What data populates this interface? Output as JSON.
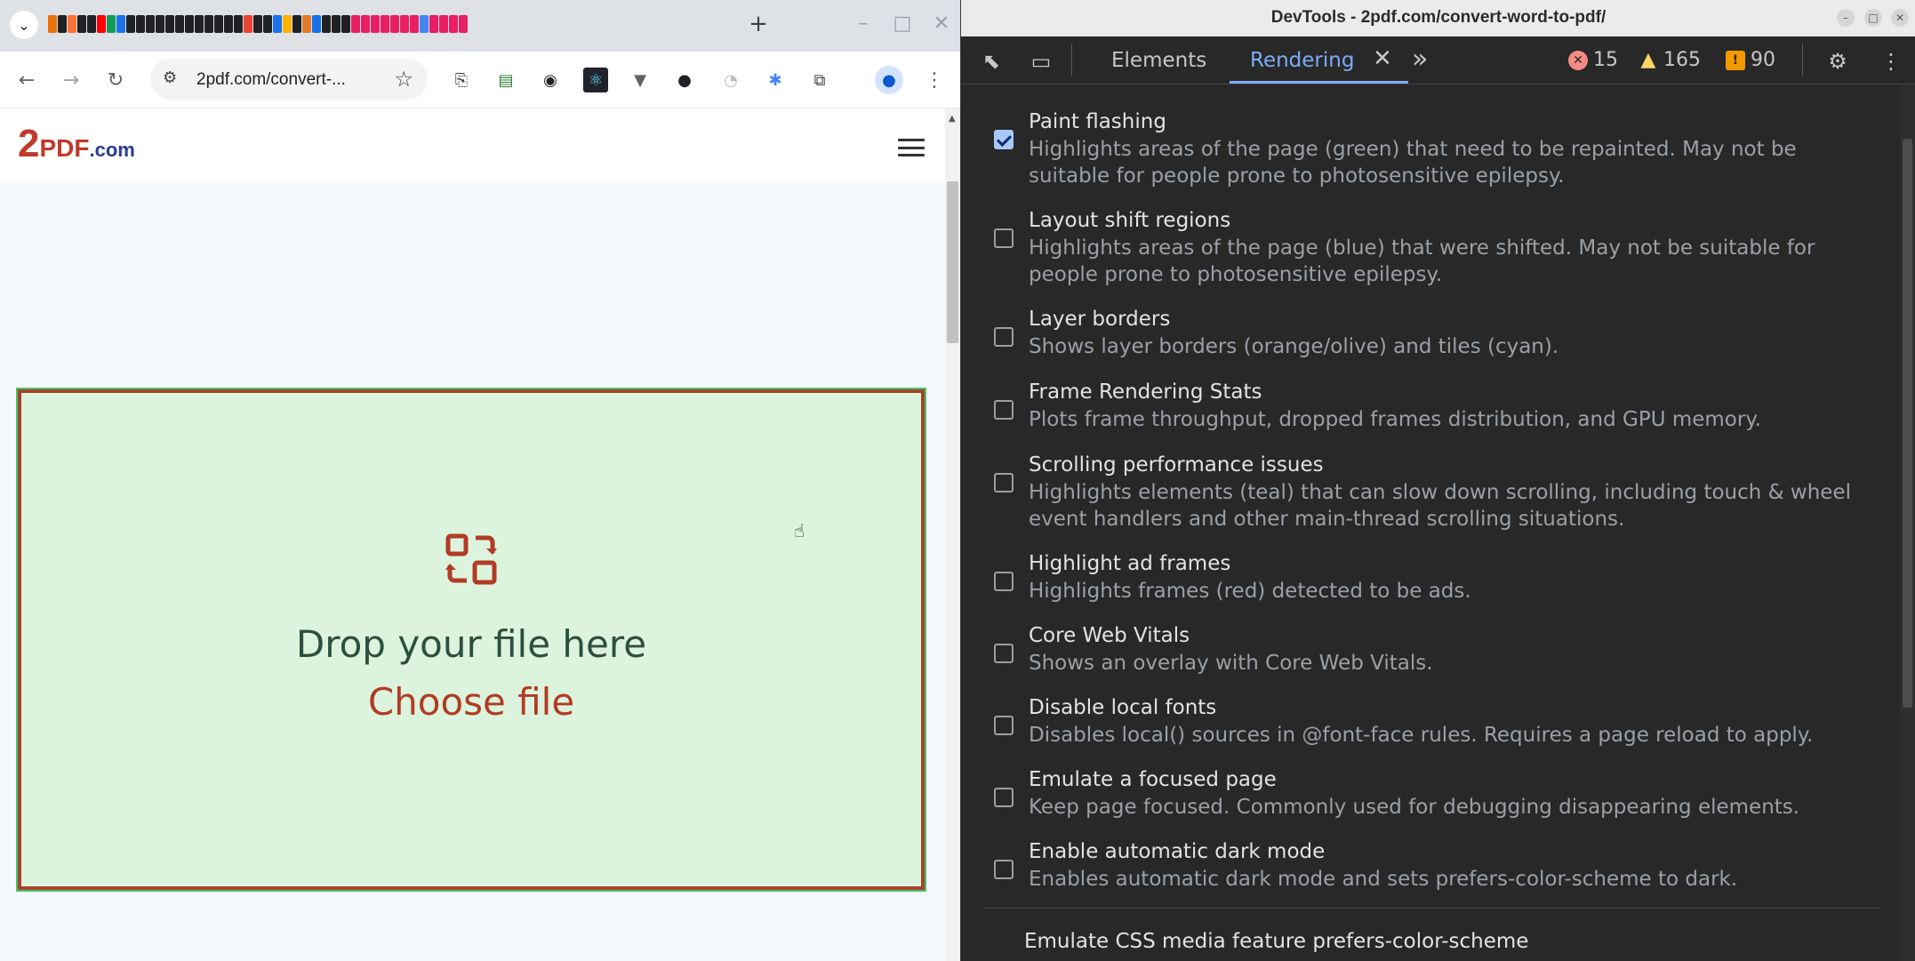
{
  "browser": {
    "url": "2pdf.com/convert-...",
    "new_tab": "+",
    "favicon_colors": [
      "#e8710a",
      "#202124",
      "#ff7139",
      "#202124",
      "#202124",
      "#ff0000",
      "#0f9d58",
      "#1a73e8",
      "#202124",
      "#202124",
      "#202124",
      "#202124",
      "#202124",
      "#202124",
      "#202124",
      "#202124",
      "#202124",
      "#202124",
      "#202124",
      "#202124",
      "#ea4335",
      "#202124",
      "#202124",
      "#1a73e8",
      "#ffb300",
      "#202124",
      "#e37a2a",
      "#1a73e8",
      "#202124",
      "#202124",
      "#202124",
      "#e91e63",
      "#e91e63",
      "#e91e63",
      "#e91e63",
      "#e91e63",
      "#e91e63",
      "#e91e63",
      "#4285f4",
      "#e91e63",
      "#e91e63",
      "#e91e63",
      "#e91e63"
    ],
    "site": {
      "logo_number": "2",
      "logo_text": "PDF",
      "logo_domain": ".com",
      "dropzone_title": "Drop your file here",
      "dropzone_button": "Choose file",
      "accent": "#b23b25",
      "dropzone_bg": "#dcf4dd"
    }
  },
  "devtools": {
    "window_title": "DevTools - 2pdf.com/convert-word-to-pdf/",
    "tabs": {
      "elements": "Elements",
      "rendering": "Rendering"
    },
    "counts": {
      "errors": "15",
      "warnings": "165",
      "issues": "90"
    },
    "options": [
      {
        "title": "Paint flashing",
        "desc": "Highlights areas of the page (green) that need to be repainted. May not be suitable for people prone to photosensitive epilepsy.",
        "checked": true
      },
      {
        "title": "Layout shift regions",
        "desc": "Highlights areas of the page (blue) that were shifted. May not be suitable for people prone to photosensitive epilepsy.",
        "checked": false
      },
      {
        "title": "Layer borders",
        "desc": "Shows layer borders (orange/olive) and tiles (cyan).",
        "checked": false
      },
      {
        "title": "Frame Rendering Stats",
        "desc": "Plots frame throughput, dropped frames distribution, and GPU memory.",
        "checked": false
      },
      {
        "title": "Scrolling performance issues",
        "desc": "Highlights elements (teal) that can slow down scrolling, including touch & wheel event handlers and other main-thread scrolling situations.",
        "checked": false
      },
      {
        "title": "Highlight ad frames",
        "desc": "Highlights frames (red) detected to be ads.",
        "checked": false
      },
      {
        "title": "Core Web Vitals",
        "desc": "Shows an overlay with Core Web Vitals.",
        "checked": false
      },
      {
        "title": "Disable local fonts",
        "desc": "Disables local() sources in @font-face rules. Requires a page reload to apply.",
        "checked": false
      },
      {
        "title": "Emulate a focused page",
        "desc": "Keep page focused. Commonly used for debugging disappearing elements.",
        "checked": false
      },
      {
        "title": "Enable automatic dark mode",
        "desc": "Enables automatic dark mode and sets prefers-color-scheme to dark.",
        "checked": false
      }
    ],
    "emulate_title": "Emulate CSS media feature prefers-color-scheme"
  }
}
